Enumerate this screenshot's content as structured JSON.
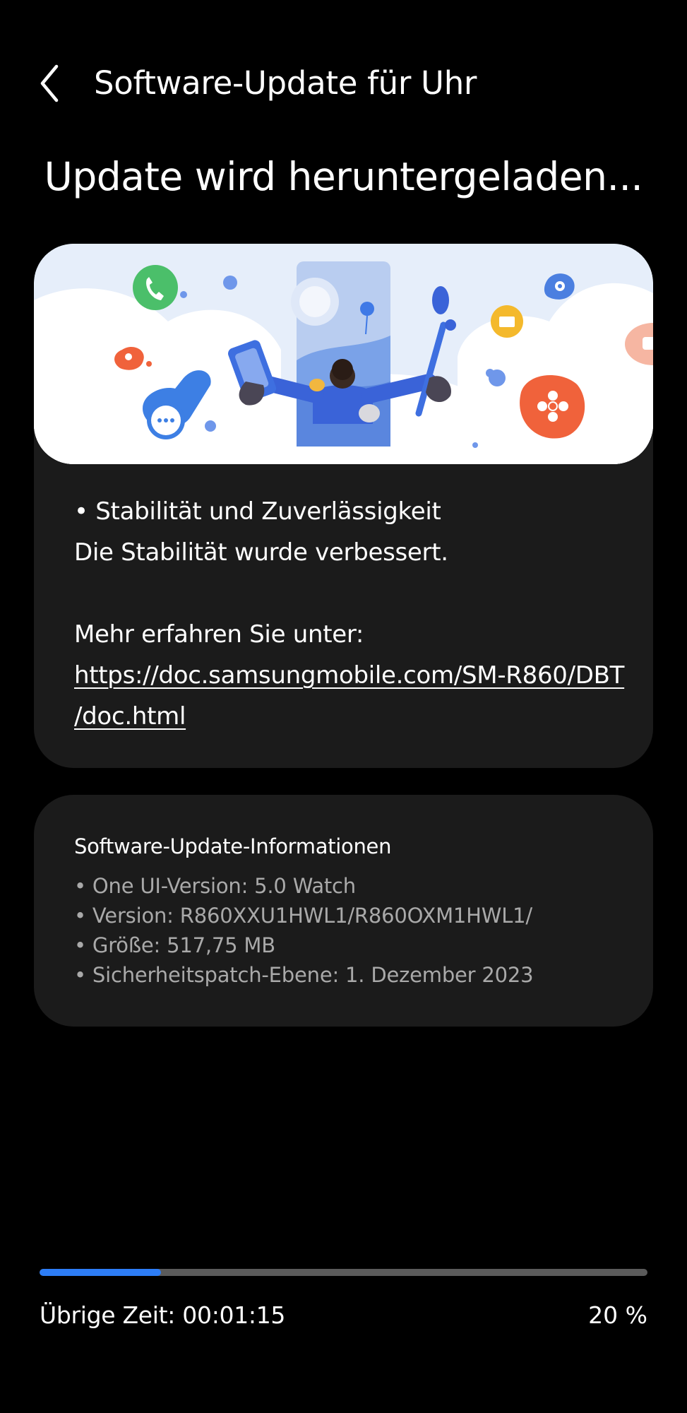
{
  "header": {
    "title": "Software-Update für Uhr",
    "back_icon": "chevron-left-icon"
  },
  "main_heading": "Update wird heruntergeladen...",
  "notes": {
    "bullet_title": "• Stabilität und Zuverlässigkeit",
    "bullet_text": "Die Stabilität wurde verbessert.",
    "more_label": "Mehr erfahren Sie unter:",
    "link_line1": "https://doc.samsungmobile.com/SM-R860/DBT",
    "link_line2": "/doc.html"
  },
  "info": {
    "title": "Software-Update-Informationen",
    "items": [
      "• One UI-Version: 5.0 Watch",
      "• Version: R860XXU1HWL1/R860OXM1HWL1/",
      "• Größe: 517,75 MB",
      "• Sicherheitspatch-Ebene: 1. Dezember 2023"
    ]
  },
  "progress": {
    "remaining_label": "Übrige Zeit: 00:01:15",
    "percent_label": "20 %",
    "fraction": 0.2
  },
  "colors": {
    "background": "#000000",
    "card": "#1b1b1b",
    "accent": "#2d7df6",
    "track": "#5b5b5b",
    "secondary_text": "#a9a9a9"
  }
}
